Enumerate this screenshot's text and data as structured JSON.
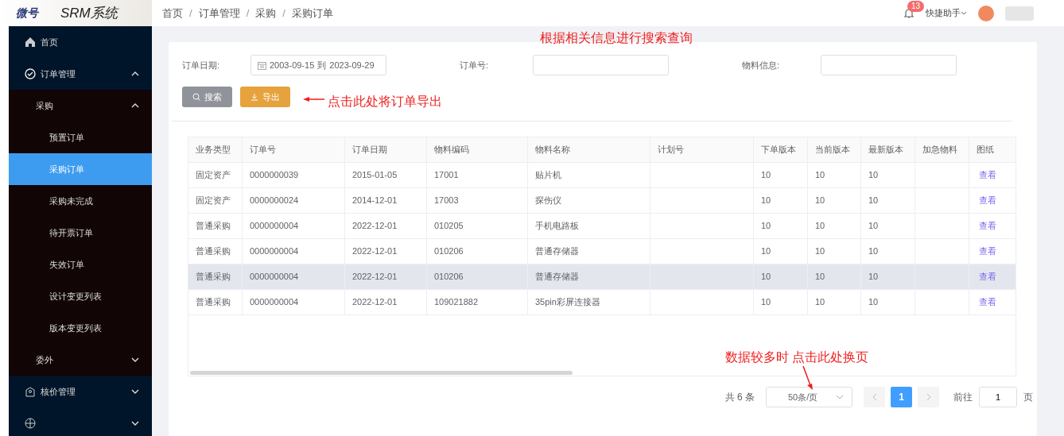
{
  "header": {
    "logo_mark": "微号",
    "system_name": "SRM系统",
    "breadcrumb": [
      "首页",
      "订单管理",
      "采购",
      "采购订单"
    ],
    "breadcrumb_separator": "/",
    "notification_count": "13",
    "quick_help": "快捷助手"
  },
  "sidebar": {
    "items": [
      {
        "label": "首页",
        "selected": false
      },
      {
        "label": "订单管理",
        "selected": false,
        "expanded": true,
        "children": [
          {
            "label": "采购",
            "selected": false,
            "expanded": true,
            "children": [
              {
                "label": "预置订单",
                "selected": false
              },
              {
                "label": "采购订单",
                "selected": true
              },
              {
                "label": "采购未完成",
                "selected": false
              },
              {
                "label": "待开票订单",
                "selected": false
              },
              {
                "label": "失效订单",
                "selected": false
              },
              {
                "label": "设计变更列表",
                "selected": false
              },
              {
                "label": "版本变更列表",
                "selected": false
              }
            ]
          },
          {
            "label": "委外",
            "selected": false,
            "expanded": false
          }
        ]
      },
      {
        "label": "核价管理",
        "selected": false,
        "expanded": false
      },
      {
        "selected": false,
        "expanded": false
      }
    ]
  },
  "filters": [
    {
      "label": "订单日期:",
      "kind": "daterange",
      "start": "2003-09-15",
      "separator": "到",
      "end": "2023-09-29"
    },
    {
      "label": "订单号:",
      "kind": "text"
    },
    {
      "label": "物料信息:",
      "kind": "text"
    }
  ],
  "buttons": [
    {
      "label": "搜索",
      "kind": "search"
    },
    {
      "label": "导出",
      "kind": "export"
    }
  ],
  "table": {
    "columns": [
      "业务类型",
      "订单号",
      "订单日期",
      "物料编码",
      "物料名称",
      "计划号",
      "下单版本",
      "当前版本",
      "最新版本",
      "加急物料",
      "图纸"
    ],
    "rows": [
      {
        "highlighted": false,
        "cells": [
          "固定资产",
          "0000000039",
          "2015-01-05",
          "17001",
          "贴片机",
          "",
          "10",
          "10",
          "10",
          "",
          "查看"
        ]
      },
      {
        "highlighted": false,
        "cells": [
          "固定资产",
          "0000000024",
          "2014-12-01",
          "17003",
          "探伤仪",
          "",
          "10",
          "10",
          "10",
          "",
          "查看"
        ]
      },
      {
        "highlighted": false,
        "cells": [
          "普通采购",
          "0000000004",
          "2022-12-01",
          "010205",
          "手机电路板",
          "",
          "10",
          "10",
          "10",
          "",
          "查看"
        ]
      },
      {
        "highlighted": false,
        "cells": [
          "普通采购",
          "0000000004",
          "2022-12-01",
          "010206",
          "普通存储器",
          "",
          "10",
          "10",
          "10",
          "",
          "查看"
        ]
      },
      {
        "highlighted": true,
        "cells": [
          "普通采购",
          "0000000004",
          "2022-12-01",
          "010206",
          "普通存储器",
          "",
          "10",
          "10",
          "10",
          "",
          "查看"
        ]
      },
      {
        "highlighted": false,
        "cells": [
          "普通采购",
          "0000000004",
          "2022-12-01",
          "109021882",
          "35pin彩屏连接器",
          "",
          "10",
          "10",
          "10",
          "",
          "查看"
        ]
      }
    ]
  },
  "pagination": {
    "total": "共 6 条",
    "page_size": "50条/页",
    "pages": [
      {
        "label": "1",
        "selected": true
      }
    ],
    "goto_label": "前往",
    "goto_value": "1",
    "page_suffix": "页"
  },
  "annotations": [
    {
      "kind": "title",
      "text": "根据相关信息进行搜索查询"
    },
    {
      "kind": "export-hint",
      "text": "点击此处将订单导出"
    },
    {
      "kind": "paging-hint",
      "text": "数据较多时 点击此处换页"
    }
  ]
}
